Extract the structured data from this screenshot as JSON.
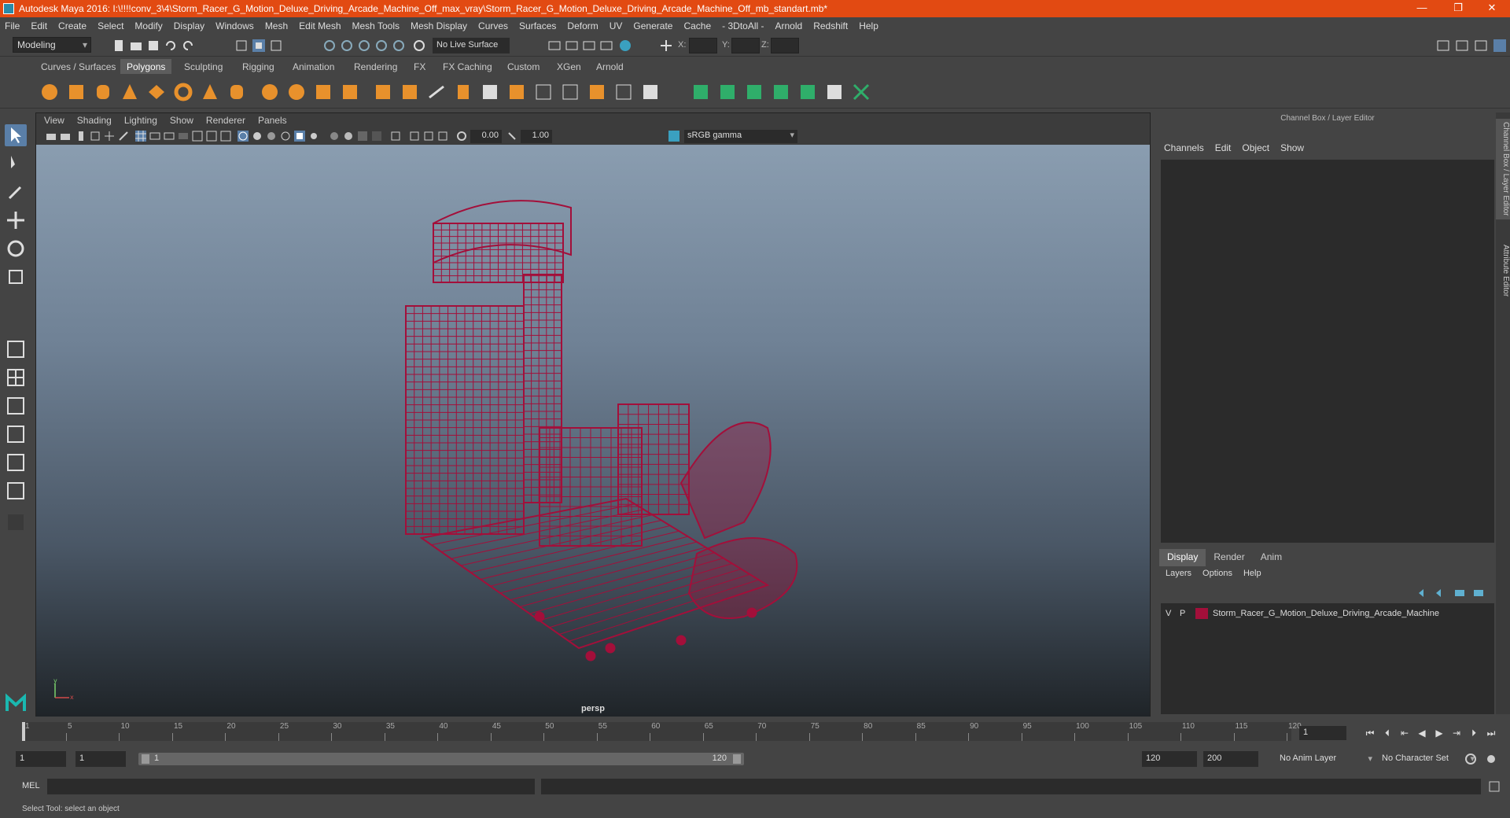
{
  "window": {
    "title": "Autodesk Maya 2016: I:\\!!!!conv_3\\4\\Storm_Racer_G_Motion_Deluxe_Driving_Arcade_Machine_Off_max_vray\\Storm_Racer_G_Motion_Deluxe_Driving_Arcade_Machine_Off_mb_standart.mb*",
    "minimize": "—",
    "maximize": "❐",
    "close": "✕"
  },
  "menubar": [
    "File",
    "Edit",
    "Create",
    "Select",
    "Modify",
    "Display",
    "Windows",
    "Mesh",
    "Edit Mesh",
    "Mesh Tools",
    "Mesh Display",
    "Curves",
    "Surfaces",
    "Deform",
    "UV",
    "Generate",
    "Cache",
    "- 3DtoAll -",
    "Arnold",
    "Redshift",
    "Help"
  ],
  "status": {
    "mode": "Modeling",
    "live_surface": "No Live Surface",
    "x_label": "X:",
    "y_label": "Y:",
    "z_label": "Z:"
  },
  "shelf": {
    "tabs": [
      "Curves / Surfaces",
      "Polygons",
      "Sculpting",
      "Rigging",
      "Animation",
      "Rendering",
      "FX",
      "FX Caching",
      "Custom",
      "XGen",
      "Arnold"
    ],
    "active_tab": "Polygons"
  },
  "viewport": {
    "menu": [
      "View",
      "Shading",
      "Lighting",
      "Show",
      "Renderer",
      "Panels"
    ],
    "near_value": "0.00",
    "far_value": "1.00",
    "color_space": "sRGB gamma",
    "camera": "persp",
    "axis_y": "y",
    "axis_x": "x",
    "wire_color": "#a30f3a"
  },
  "channel_box": {
    "title": "Channel Box / Layer Editor",
    "menu": [
      "Channels",
      "Edit",
      "Object",
      "Show"
    ],
    "layer_tabs": [
      "Display",
      "Render",
      "Anim"
    ],
    "active_layer_tab": "Display",
    "layer_menu": [
      "Layers",
      "Options",
      "Help"
    ],
    "layer": {
      "visible": "V",
      "playback": "P",
      "name": "Storm_Racer_G_Motion_Deluxe_Driving_Arcade_Machine",
      "color": "#a30f3a"
    }
  },
  "side_tabs": [
    "Channel Box / Layer Editor",
    "Attribute Editor"
  ],
  "timeslider": {
    "ticks": [
      "1",
      "5",
      "10",
      "15",
      "20",
      "25",
      "30",
      "35",
      "40",
      "45",
      "50",
      "55",
      "60",
      "65",
      "70",
      "75",
      "80",
      "85",
      "90",
      "95",
      "100",
      "105",
      "110",
      "115",
      "120"
    ],
    "current_frame": "1"
  },
  "range": {
    "start": "1",
    "playback_start": "1",
    "inner_start": "1",
    "inner_end": "120",
    "playback_end": "120",
    "end": "200",
    "anim_layer": "No Anim Layer",
    "character_set": "No Character Set"
  },
  "mel": {
    "label": "MEL"
  },
  "help_line": "Select Tool: select an object"
}
